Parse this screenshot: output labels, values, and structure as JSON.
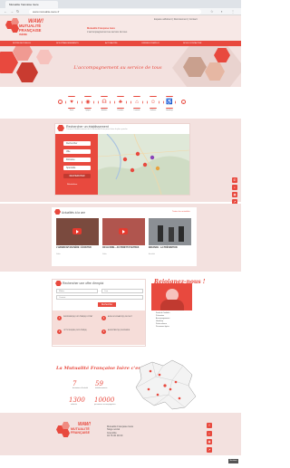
{
  "browser": {
    "tab_title": "Mutualite francaise Isere",
    "url": "www.mutualite-isere.fr"
  },
  "header": {
    "brand_line1": "MUTUALITÉ",
    "brand_line2": "FRANÇAISE",
    "brand_line3": "ISÈRE",
    "wow": "WAW!",
    "tagline": "Mutualité Française Isère",
    "sub": "L'accompagnement au service de tous",
    "top_links": "Espace adhérent | Recrutement | Contact"
  },
  "nav": {
    "items": [
      "NOTRE MUTUELLE",
      "NOS ÉTABLISSEMENTS",
      "ACTUALITÉS",
      "OFFRES D'EMPLOI",
      "NOUS CONTACTER"
    ]
  },
  "hero": {
    "title": "L'accompagnement au service de tous"
  },
  "services": {
    "items": [
      {
        "icon": "care-icon",
        "glyph": "♥",
        "label": "Soins"
      },
      {
        "icon": "optic-icon",
        "glyph": "◉",
        "label": "Optique"
      },
      {
        "icon": "ear-icon",
        "glyph": "☊",
        "label": "Audition"
      },
      {
        "icon": "tooth-icon",
        "glyph": "♣",
        "label": "Dentaire"
      },
      {
        "icon": "home-icon",
        "glyph": "⌂",
        "label": "Domicile"
      },
      {
        "icon": "child-icon",
        "glyph": "☺",
        "label": "Enfance"
      },
      {
        "icon": "senior-icon",
        "glyph": "♿",
        "label": "Handicap"
      }
    ]
  },
  "finder": {
    "title": "Rechercher un établissement",
    "subtitle": "Trouvez l'établissement de la Mutualité Française Isère le plus proche",
    "fields": [
      "Rechercher",
      "Ville",
      "Domaine",
      "Spécialité"
    ],
    "button": "RECHERCHER",
    "reset": "Réinitialiser"
  },
  "news": {
    "title": "Actualités à la une",
    "all": "Toutes les actualités",
    "cards": [
      {
        "caption": "L'HANDICAP EN ISÈRE : ÉCOUTER",
        "sub": "Vidéo"
      },
      {
        "caption": "ON LE DIRE... AU PROFIT D'AUTRES",
        "sub": "Vidéo"
      },
      {
        "caption": "ENFANCE : LA PRÉVENTION",
        "sub": "Actualité"
      }
    ]
  },
  "jobs": {
    "title": "Rechercher une offre d'emploi",
    "field1": "Métier",
    "field2": "Lieu",
    "field3": "Contrat",
    "button": "Rechercher",
    "tiles": [
      {
        "n": "1",
        "label": "INFIRMIER(E) DIPLÔMÉ(E) D'ÉTAT"
      },
      {
        "n": "2",
        "label": "AIDE-SOIGNANT(E) DE NUIT"
      },
      {
        "n": "3",
        "label": "OPTICIEN(NE) DIPLÔMÉ(E)"
      },
      {
        "n": "4",
        "label": "ASSISTANT(E) DENTAIRE"
      }
    ],
    "promo_hand": "Rejoignez-nous !",
    "promo_list": [
      "Santé de l'individu",
      "Prévention",
      "Accompagnement",
      "Handicap",
      "Petite enfance",
      "Personnes âgées"
    ]
  },
  "stats": {
    "title": "La Mutualité Française Isère c'est :",
    "items": [
      {
        "n": "7",
        "l": "domaines d'activité"
      },
      {
        "n": "59",
        "l": "établissements"
      },
      {
        "n": "1300",
        "l": "salariés"
      },
      {
        "n": "10000",
        "l": "personnes accompagnées"
      }
    ]
  },
  "footer": {
    "addr1": "Mutualité Française Isère",
    "addr2": "Siège social",
    "addr3": "Grenoble",
    "phone": "04 76 00 00 00",
    "legal": "Mentions légales"
  },
  "colors": {
    "accent": "#e8493e",
    "soft": "#f3e1df"
  }
}
